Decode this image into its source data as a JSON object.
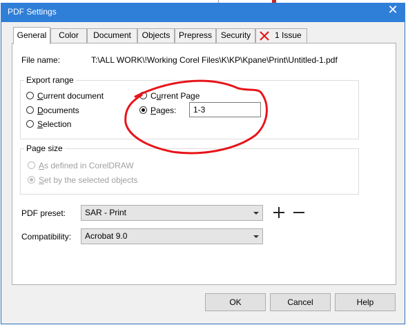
{
  "dialog": {
    "title": "PDF Settings",
    "close_label": "✕"
  },
  "tabs": [
    {
      "label": "General",
      "active": true
    },
    {
      "label": "Color"
    },
    {
      "label": "Document"
    },
    {
      "label": "Objects"
    },
    {
      "label": "Prepress"
    },
    {
      "label": "Security"
    },
    {
      "label": "1 Issue",
      "icon": "error-x-icon"
    }
  ],
  "file": {
    "label": "File name:",
    "value": "T:\\ALL WORK\\!Working Corel Files\\K\\KP\\Kpane\\Print\\Untitled-1.pdf"
  },
  "export_range": {
    "title": "Export range",
    "options": {
      "current_document": "Current document",
      "documents": "Documents",
      "selection": "Selection",
      "current_page": "Current Page",
      "pages": "Pages:"
    },
    "selected": "pages",
    "pages_value": "1-3"
  },
  "page_size": {
    "title": "Page size",
    "options": {
      "as_defined": "As defined in CorelDRAW",
      "selected_objects": "Set by the selected objects"
    },
    "selected": "selected_objects",
    "disabled": true
  },
  "pdf_preset": {
    "label": "PDF preset:",
    "value": "SAR - Print",
    "add_icon": "plus-icon",
    "remove_icon": "minus-icon"
  },
  "compatibility": {
    "label": "Compatibility:",
    "value": "Acrobat 9.0"
  },
  "buttons": {
    "ok": "OK",
    "cancel": "Cancel",
    "help": "Help"
  },
  "colors": {
    "titlebar": "#2f7fd8",
    "annotation": "#e8141a",
    "issue_x": "#e8141a"
  }
}
